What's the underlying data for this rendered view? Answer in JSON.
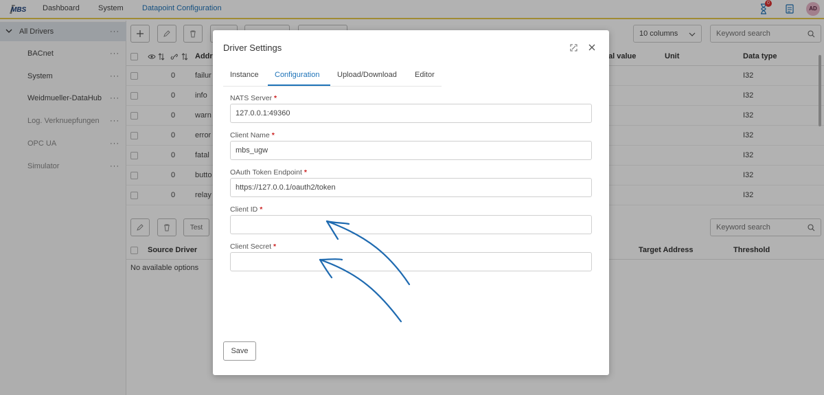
{
  "app": {
    "logo_text": "MBS",
    "hourglass_badge": "0",
    "avatar_initials": "AD"
  },
  "nav": {
    "dashboard": "Dashboard",
    "system": "System",
    "datapoint_config": "Datapoint Configuration"
  },
  "sidebar": {
    "root": "All Drivers",
    "items": [
      "BACnet",
      "System",
      "Weidmueller-DataHub",
      "Log. Verknuepfungen",
      "OPC UA",
      "Simulator"
    ],
    "dots": "···"
  },
  "toolbar": {
    "test_label": "Test",
    "columns_select": "10 columns",
    "search_placeholder": "Keyword search"
  },
  "table": {
    "headers": {
      "address": "Addr",
      "initial_value": "al value",
      "unit": "Unit",
      "data_type": "Data type"
    },
    "rows": [
      {
        "count": "0",
        "address": "failur",
        "data_type": "I32"
      },
      {
        "count": "0",
        "address": "info",
        "data_type": "I32"
      },
      {
        "count": "0",
        "address": "warn",
        "data_type": "I32"
      },
      {
        "count": "0",
        "address": "error",
        "data_type": "I32"
      },
      {
        "count": "0",
        "address": "fatal",
        "data_type": "I32"
      },
      {
        "count": "0",
        "address": "butto",
        "data_type": "I32"
      },
      {
        "count": "0",
        "address": "relay",
        "data_type": "I32"
      }
    ]
  },
  "lower_table": {
    "headers": {
      "source_driver": "Source Driver",
      "target_address": "Target Address",
      "threshold": "Threshold"
    },
    "empty_text": "No available options"
  },
  "modal": {
    "title": "Driver Settings",
    "tabs": [
      "Instance",
      "Configuration",
      "Upload/Download",
      "Editor"
    ],
    "active_tab": "Configuration",
    "fields": {
      "nats_server": {
        "label": "NATS Server",
        "value": "127.0.0.1:49360"
      },
      "client_name": {
        "label": "Client Name",
        "value": "mbs_ugw"
      },
      "oauth_endpoint": {
        "label": "OAuth Token Endpoint",
        "value": "https://127.0.0.1/oauth2/token"
      },
      "client_id": {
        "label": "Client ID",
        "value": ""
      },
      "client_secret": {
        "label": "Client Secret",
        "value": ""
      }
    },
    "required_marker": "*",
    "save_label": "Save"
  },
  "colors": {
    "accent": "#1e73b8",
    "nav_underline": "#e6c84a",
    "required": "#c22222",
    "arrow": "#1e6ab0"
  },
  "icons": [
    "logo-icon",
    "hourglass-icon",
    "document-icon",
    "chevron-down-icon",
    "plus-icon",
    "pencil-icon",
    "trash-icon",
    "eye-icon",
    "link-icon",
    "sort-icon",
    "search-icon",
    "expand-icon",
    "close-icon"
  ]
}
